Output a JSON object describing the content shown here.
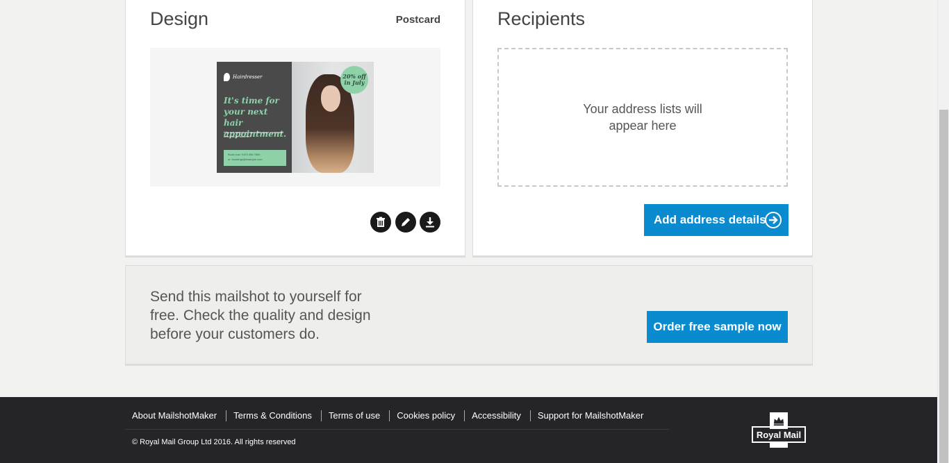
{
  "design_card": {
    "title": "Design",
    "format_label": "Postcard",
    "postcard": {
      "brand": "Hairdresser",
      "headline": "It's time for your next hair appointment.",
      "subtext": "Why not contact us now to talk about your brand new look for summer?",
      "booking_line1": "Book now: 0123 456 7890",
      "booking_line2": "or: bookings@example.com",
      "badge_text": "20% off in July"
    },
    "actions": {
      "delete_icon": "trash-icon",
      "edit_icon": "pencil-icon",
      "download_icon": "download-icon"
    }
  },
  "recipients_card": {
    "title": "Recipients",
    "empty_message": "Your address lists will appear here",
    "add_button_label": "Add address details"
  },
  "sample_panel": {
    "message": "Send this mailshot to yourself for free. Check the quality and design before your customers do.",
    "order_button_label": "Order free sample now"
  },
  "footer": {
    "links": [
      "About MailshotMaker",
      "Terms & Conditions",
      "Terms of use",
      "Cookies policy",
      "Accessibility",
      "Support for MailshotMaker"
    ],
    "copyright": "© Royal Mail Group Ltd 2016. All rights reserved",
    "logo_text": "Royal Mail"
  },
  "colors": {
    "accent_blue": "#0a8bd0",
    "footer_bg": "#252428",
    "postcard_green": "#8fd2a9"
  }
}
